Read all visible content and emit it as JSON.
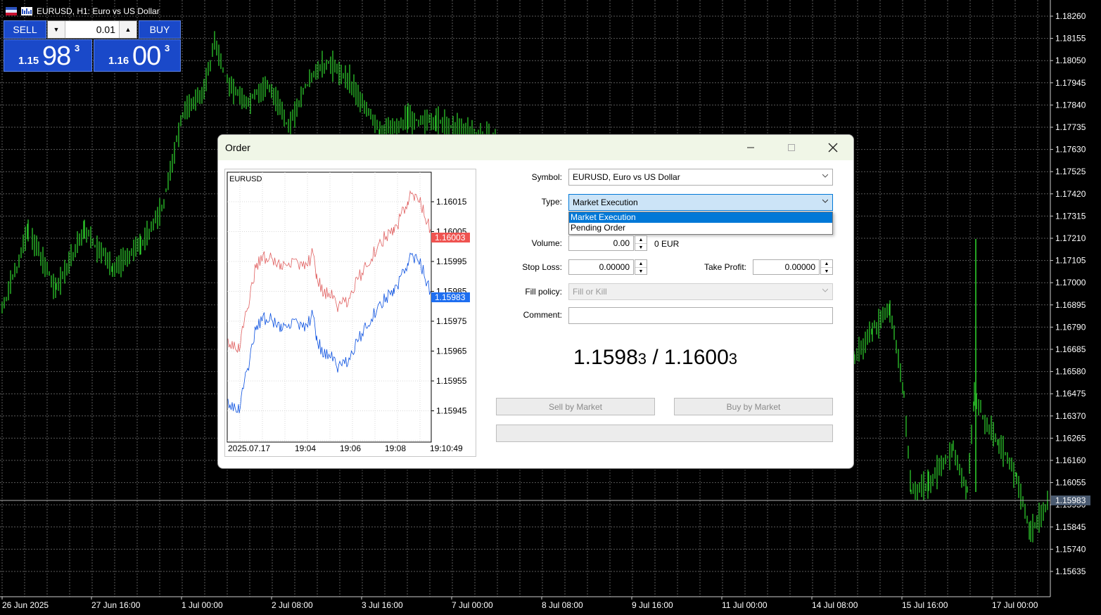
{
  "header": {
    "title": "EURUSD, H1:  Euro vs US Dollar"
  },
  "trade_panel": {
    "sell_label": "SELL",
    "buy_label": "BUY",
    "volume": "0.01",
    "bid": {
      "prefix": "1.15",
      "big": "98",
      "sup": "3"
    },
    "ask": {
      "prefix": "1.16",
      "big": "00",
      "sup": "3"
    },
    "color": "#1a49c9"
  },
  "main_chart": {
    "type": "candlestick",
    "y_ticks": [
      "1.18260",
      "1.18155",
      "1.18050",
      "1.17945",
      "1.17840",
      "1.17735",
      "1.17630",
      "1.17525",
      "1.17420",
      "1.17315",
      "1.17210",
      "1.17105",
      "1.17000",
      "1.16895",
      "1.16790",
      "1.16685",
      "1.16580",
      "1.16475",
      "1.16370",
      "1.16265",
      "1.16160",
      "1.16055",
      "1.15950",
      "1.15845",
      "1.15740",
      "1.15635"
    ],
    "x_ticks": [
      "26 Jun 2025",
      "27 Jun 16:00",
      "1 Jul 00:00",
      "2 Jul 08:00",
      "3 Jul 16:00",
      "7 Jul 00:00",
      "8 Jul 08:00",
      "9 Jul 16:00",
      "11 Jul 00:00",
      "14 Jul 08:00",
      "15 Jul 16:00",
      "17 Jul 00:00"
    ],
    "current_price": "1.15983",
    "colors": {
      "background": "#000000",
      "candle": "#31d92e",
      "grid": "#5a5a5a"
    }
  },
  "dialog": {
    "title": "Order",
    "mini_chart": {
      "symbol": "EURUSD",
      "y_ticks": [
        "1.16015",
        "1.16005",
        "1.15995",
        "1.15985",
        "1.15975",
        "1.15965",
        "1.15955",
        "1.15945"
      ],
      "x_ticks": [
        "2025.07.17",
        "19:04",
        "19:06",
        "19:08",
        "19:10:49"
      ],
      "ask_label": "1.16003",
      "bid_label": "1.15983",
      "colors": {
        "ask": "#e06060",
        "bid": "#0a50e0",
        "ask_tag": "#ef5350",
        "bid_tag": "#1e6ef0"
      }
    },
    "fields": {
      "symbol": {
        "label": "Symbol:",
        "value": "EURUSD, Euro vs US Dollar"
      },
      "type": {
        "label": "Type:",
        "value": "Market Execution",
        "options": [
          "Market Execution",
          "Pending Order"
        ]
      },
      "volume": {
        "label": "Volume:",
        "value": "0.00",
        "unit": "0 EUR"
      },
      "stop_loss": {
        "label": "Stop Loss:",
        "value": "0.00000"
      },
      "take_profit": {
        "label": "Take Profit:",
        "value": "0.00000"
      },
      "fill_policy": {
        "label": "Fill policy:",
        "value": "Fill or Kill"
      },
      "comment": {
        "label": "Comment:",
        "value": ""
      }
    },
    "price_display": {
      "bid_main": "1.1598",
      "bid_small": "3",
      "separator": " / ",
      "ask_main": "1.1600",
      "ask_small": "3"
    },
    "buttons": {
      "sell": "Sell by Market",
      "buy": "Buy by Market"
    }
  }
}
